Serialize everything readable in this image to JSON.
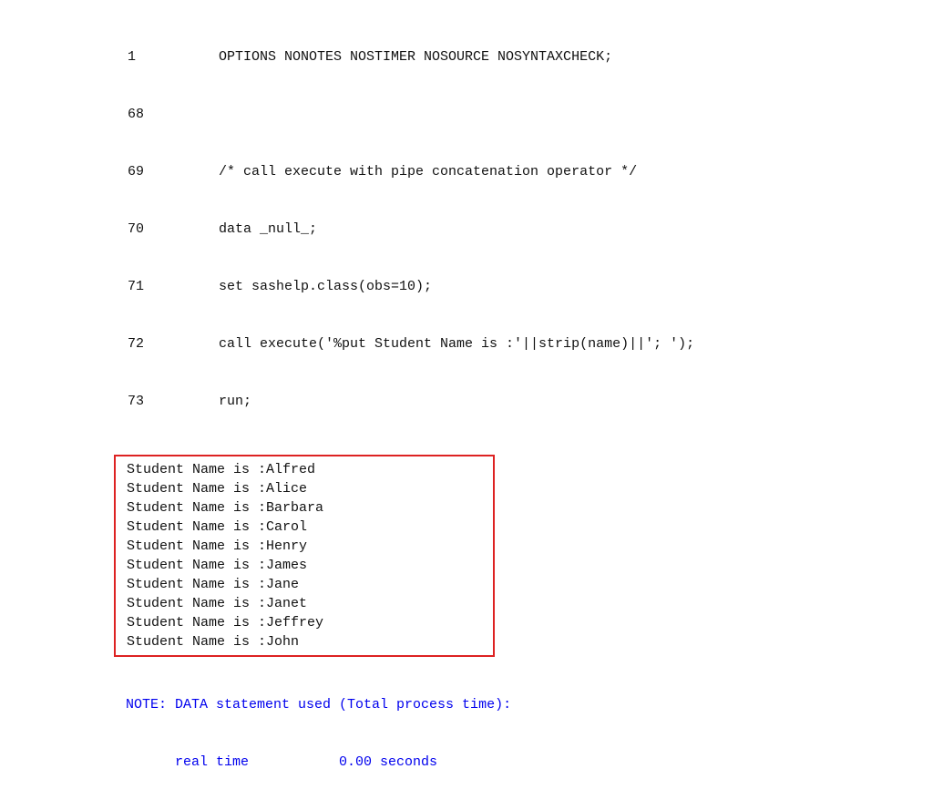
{
  "code": [
    {
      "ln": "1",
      "src": "OPTIONS NONOTES NOSTIMER NOSOURCE NOSYNTAXCHECK;"
    },
    {
      "ln": "68",
      "src": ""
    },
    {
      "ln": "69",
      "src": "/* call execute with pipe concatenation operator */"
    },
    {
      "ln": "70",
      "src": "data _null_;"
    },
    {
      "ln": "71",
      "src": "set sashelp.class(obs=10);"
    },
    {
      "ln": "72",
      "src": "call execute('%put Student Name is :'||strip(name)||'; ');"
    },
    {
      "ln": "73",
      "src": "run;"
    }
  ],
  "output": [
    "Student Name is :Alfred",
    "Student Name is :Alice",
    "Student Name is :Barbara",
    "Student Name is :Carol",
    "Student Name is :Henry",
    "Student Name is :James",
    "Student Name is :Jane",
    "Student Name is :Janet",
    "Student Name is :Jeffrey",
    "Student Name is :John"
  ],
  "note": {
    "line1": "NOTE: DATA statement used (Total process time):",
    "line2": "      real time           0.00 seconds"
  }
}
